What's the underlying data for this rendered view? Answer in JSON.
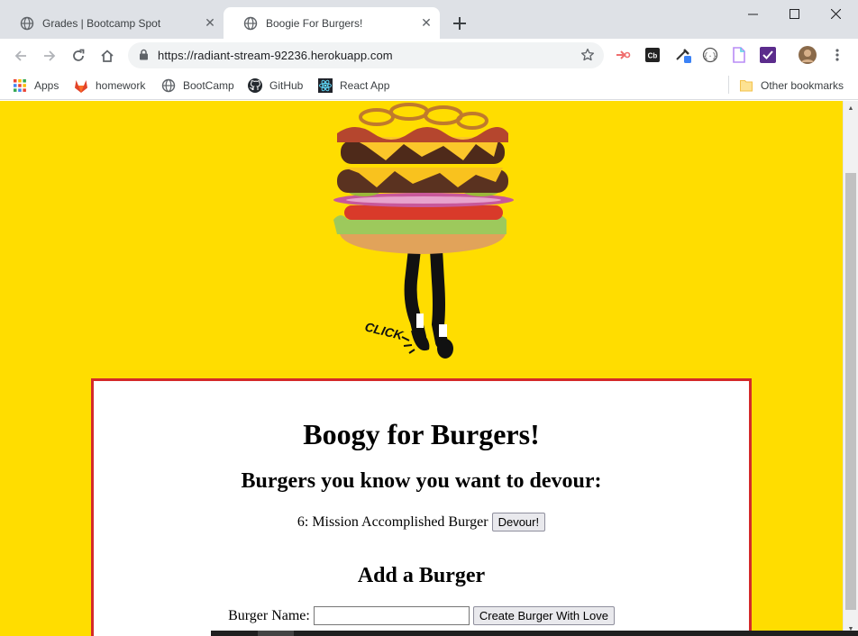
{
  "tabs": [
    {
      "title": "Grades | Bootcamp Spot",
      "active": false
    },
    {
      "title": "Boogie For Burgers!",
      "active": true
    }
  ],
  "toolbar": {
    "url": "https://radiant-stream-92236.herokuapp.com"
  },
  "bookmarks": {
    "items": [
      {
        "label": "Apps",
        "icon": "apps-grid-icon"
      },
      {
        "label": "homework",
        "icon": "gitlab-icon"
      },
      {
        "label": "BootCamp",
        "icon": "globe-icon"
      },
      {
        "label": "GitHub",
        "icon": "github-icon"
      },
      {
        "label": "React App",
        "icon": "react-icon"
      }
    ],
    "other": "Other bookmarks"
  },
  "page": {
    "background_color": "#ffdd00",
    "card_border_color": "#d42a2a",
    "hero_click_text": "CLICK",
    "title": "Boogy for Burgers!",
    "devour_heading": "Burgers you know you want to devour:",
    "burgers": [
      {
        "label": "6: Mission Accomplished Burger",
        "button": "Devour!"
      }
    ],
    "add_heading": "Add a Burger",
    "form": {
      "label": "Burger Name:",
      "value": "",
      "submit": "Create Burger With Love"
    }
  }
}
